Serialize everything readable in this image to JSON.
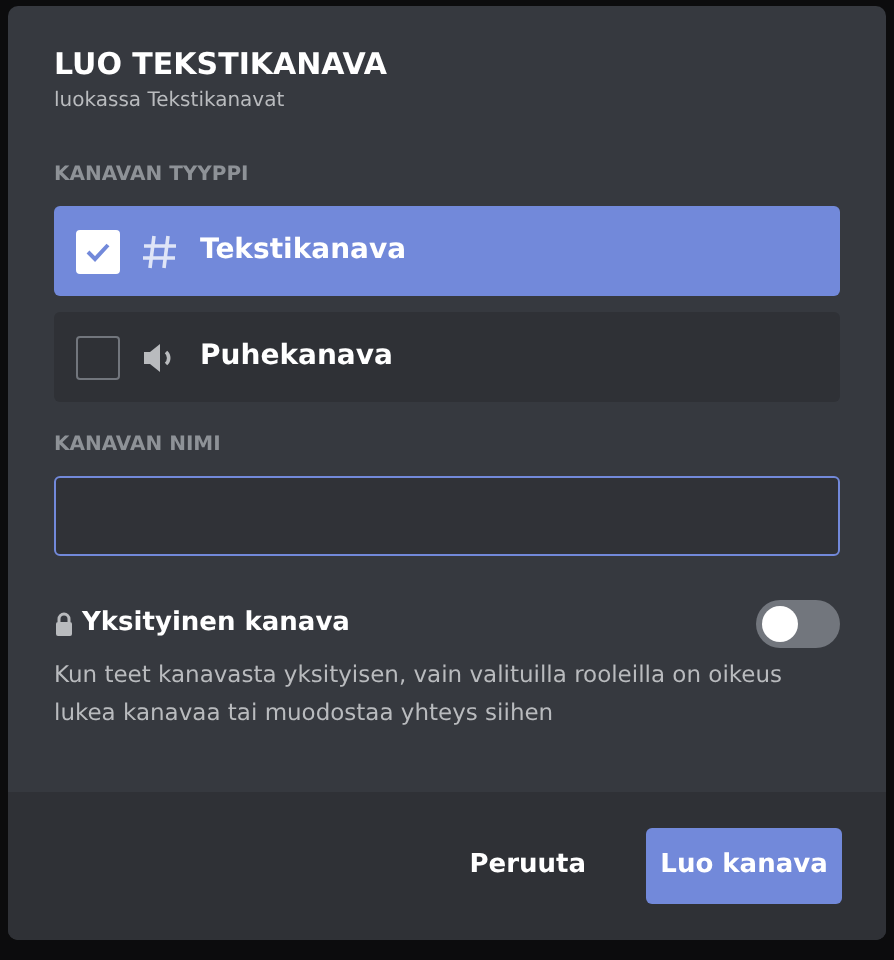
{
  "dialog": {
    "title": "LUO TEKSTIKANAVA",
    "subtitle": "luokassa Tekstikanavat"
  },
  "channel_type": {
    "label": "KANAVAN TYYPPI",
    "options": [
      {
        "kind": "text",
        "label": "Tekstikanava",
        "selected": true
      },
      {
        "kind": "voice",
        "label": "Puhekanava",
        "selected": false
      }
    ]
  },
  "channel_name": {
    "label": "KANAVAN NIMI",
    "focused": true
  },
  "private": {
    "label": "Yksityinen kanava",
    "on": false,
    "description": "Kun teet kanavasta yksityisen, vain valituilla rooleilla on oikeus lukea kanavaa tai muodostaa yhteys siihen"
  },
  "buttons": [
    {
      "kind": "cancel",
      "label": "Peruuta"
    },
    {
      "kind": "primary",
      "label": "Luo kanava"
    }
  ]
}
